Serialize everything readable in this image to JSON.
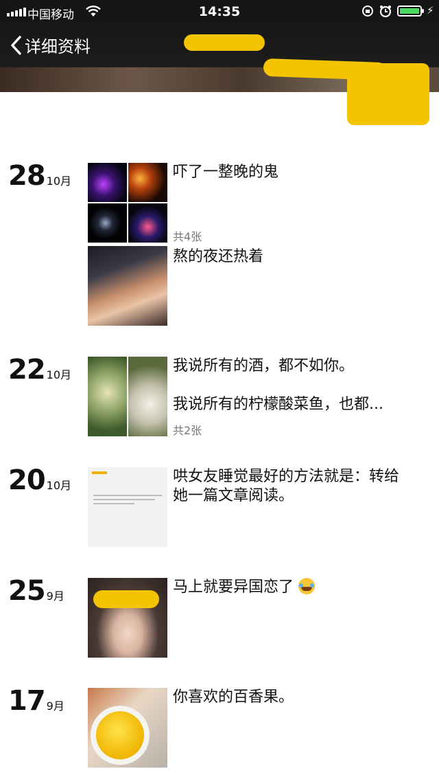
{
  "status_bar": {
    "carrier": "中国移动",
    "time": "14:35"
  },
  "navbar": {
    "back_label": "详细资料"
  },
  "posts": [
    {
      "day": "28",
      "month": "10月",
      "caption": "吓了一整晚的鬼",
      "count": "共4张"
    },
    {
      "caption": "熬的夜还热着"
    },
    {
      "day": "22",
      "month": "10月",
      "caption": "我说所有的酒，都不如你。",
      "caption2": "我说所有的柠檬酸菜鱼，也都...",
      "count": "共2张"
    },
    {
      "day": "20",
      "month": "10月",
      "caption": "哄女友睡觉最好的方法就是：转给她一篇文章阅读。"
    },
    {
      "day": "25",
      "month": "9月",
      "caption": "马上就要异国恋了"
    },
    {
      "day": "17",
      "month": "9月",
      "caption": "你喜欢的百香果。"
    }
  ],
  "colors": {
    "redaction": "#f5c400",
    "battery": "#4cd964"
  }
}
